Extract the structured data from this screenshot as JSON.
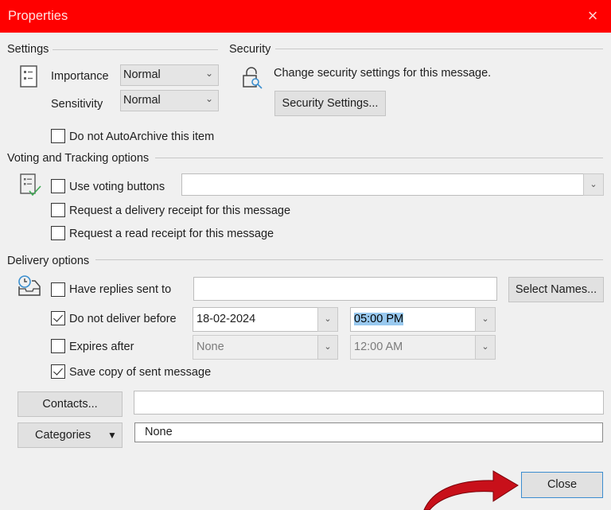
{
  "window": {
    "title": "Properties",
    "close_icon": "×"
  },
  "settings": {
    "title": "Settings",
    "importance_label": "Importance",
    "importance_value": "Normal",
    "sensitivity_label": "Sensitivity",
    "sensitivity_value": "Normal",
    "autoarchive_label": "Do not AutoArchive this item",
    "autoarchive_checked": false
  },
  "security": {
    "title": "Security",
    "description": "Change security settings for this message.",
    "button_label": "Security Settings..."
  },
  "voting": {
    "title": "Voting and Tracking options",
    "use_voting_label": "Use voting buttons",
    "use_voting_checked": false,
    "voting_value": "",
    "delivery_receipt_label": "Request a delivery receipt for this message",
    "delivery_receipt_checked": false,
    "read_receipt_label": "Request a read receipt for this message",
    "read_receipt_checked": false
  },
  "delivery": {
    "title": "Delivery options",
    "replies_label": "Have replies sent to",
    "replies_checked": false,
    "replies_value": "",
    "select_names_label": "Select Names...",
    "deliver_before_label": "Do not deliver before",
    "deliver_before_checked": true,
    "deliver_date": "18-02-2024",
    "deliver_time": "05:00 PM",
    "expires_label": "Expires after",
    "expires_checked": false,
    "expires_date": "None",
    "expires_time": "12:00 AM",
    "save_copy_label": "Save copy of sent message",
    "save_copy_checked": true
  },
  "contacts": {
    "button_label": "Contacts...",
    "value": ""
  },
  "categories": {
    "button_label": "Categories",
    "value": "None"
  },
  "footer": {
    "close_label": "Close"
  },
  "colors": {
    "titlebar": "#ff0000",
    "annotation_arrow": "#c8101a"
  }
}
